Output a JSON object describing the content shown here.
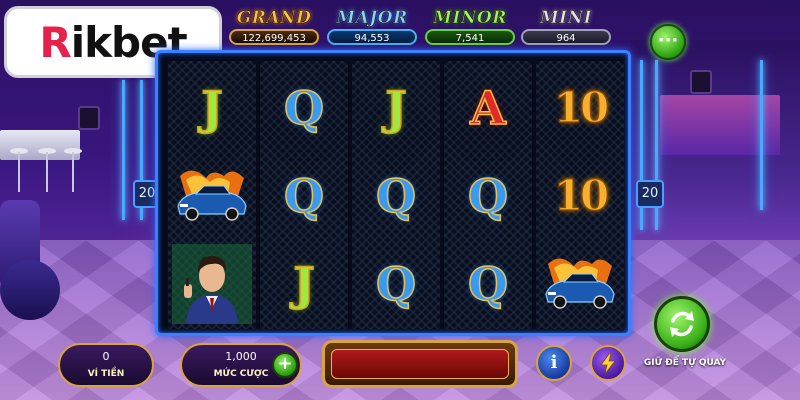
{
  "brand": {
    "logo_r": "R",
    "logo_rest": "ikbet"
  },
  "jackpots": [
    {
      "title": "GRAND",
      "value": "122,699,453"
    },
    {
      "title": "MAJOR",
      "value": "94,553"
    },
    {
      "title": "MINOR",
      "value": "7,541"
    },
    {
      "title": "MINI",
      "value": "964"
    }
  ],
  "menu": {
    "label": "···"
  },
  "paylines": {
    "left": "20",
    "right": "20"
  },
  "reels": [
    [
      "J",
      "car",
      "agent"
    ],
    [
      "Q",
      "Q",
      "J"
    ],
    [
      "J",
      "Q",
      "Q"
    ],
    [
      "A",
      "Q",
      "Q"
    ],
    [
      "10",
      "10",
      "car"
    ]
  ],
  "symbol_icons": {
    "car": "sports-car-icon",
    "agent": "secret-agent-icon"
  },
  "controls": {
    "wallet_value": "0",
    "wallet_label": "VÍ TIỀN",
    "bet_value": "1,000",
    "bet_label": "MỨC CƯỢC",
    "minus": "−",
    "plus": "+",
    "info": "i",
    "autospin_label": "GIỮ ĐỂ TỰ QUAY"
  },
  "colors": {
    "accent": "#3a80ff",
    "gold": "#d8a440",
    "green": "#3ab018",
    "brand_red": "#e6224a"
  }
}
